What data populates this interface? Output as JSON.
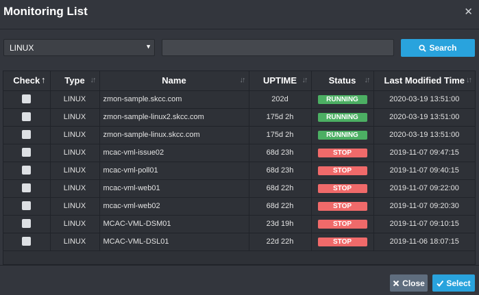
{
  "dialog": {
    "title": "Monitoring List"
  },
  "toolbar": {
    "os_selected": "LINUX",
    "search_value": "",
    "search_label": "Search"
  },
  "table": {
    "columns": [
      "Check",
      "Type",
      "Name",
      "UPTIME",
      "Status",
      "Last Modified Time"
    ],
    "rows": [
      {
        "type": "LINUX",
        "name": "zmon-sample.skcc.com",
        "uptime": "202d",
        "status": "RUNNING",
        "modified": "2020-03-19 13:51:00"
      },
      {
        "type": "LINUX",
        "name": "zmon-sample-linux2.skcc.com",
        "uptime": "175d 2h",
        "status": "RUNNING",
        "modified": "2020-03-19 13:51:00"
      },
      {
        "type": "LINUX",
        "name": "zmon-sample-linux.skcc.com",
        "uptime": "175d 2h",
        "status": "RUNNING",
        "modified": "2020-03-19 13:51:00"
      },
      {
        "type": "LINUX",
        "name": "mcac-vml-issue02",
        "uptime": "68d 23h",
        "status": "STOP",
        "modified": "2019-11-07 09:47:15"
      },
      {
        "type": "LINUX",
        "name": "mcac-vml-poll01",
        "uptime": "68d 23h",
        "status": "STOP",
        "modified": "2019-11-07 09:40:15"
      },
      {
        "type": "LINUX",
        "name": "mcac-vml-web01",
        "uptime": "68d 22h",
        "status": "STOP",
        "modified": "2019-11-07 09:22:00"
      },
      {
        "type": "LINUX",
        "name": "mcac-vml-web02",
        "uptime": "68d 22h",
        "status": "STOP",
        "modified": "2019-11-07 09:20:30"
      },
      {
        "type": "LINUX",
        "name": "MCAC-VML-DSM01",
        "uptime": "23d 19h",
        "status": "STOP",
        "modified": "2019-11-07 09:10:15"
      },
      {
        "type": "LINUX",
        "name": "MCAC-VML-DSL01",
        "uptime": "22d 22h",
        "status": "STOP",
        "modified": "2019-11-06 18:07:15"
      }
    ]
  },
  "footer": {
    "close_label": "Close",
    "select_label": "Select"
  },
  "colors": {
    "running": "#4caf63",
    "stop": "#f06a6a",
    "accent": "#29a3dd"
  }
}
